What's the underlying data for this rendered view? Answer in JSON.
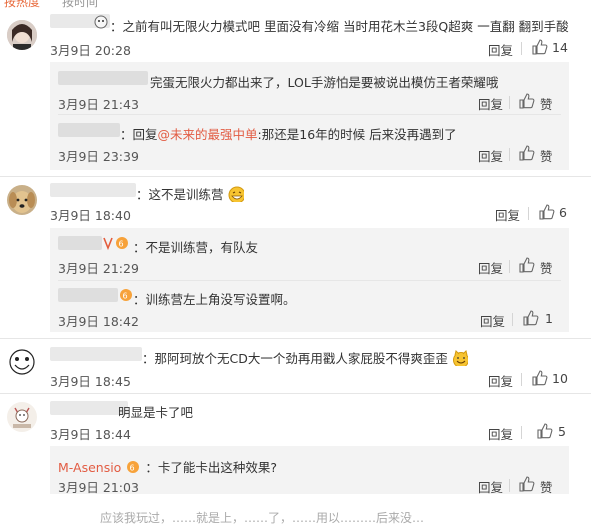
{
  "top": {
    "cut_label_1": "按热度",
    "cut_label_2": "按时间"
  },
  "comments": [
    {
      "text": "：之前有叫无限火力模式吧 里面没有冷缩  当时用花木兰3段Q超爽  一直翻  翻到手酸",
      "time": "3月9日 20:28",
      "reply_label": "回复",
      "likes": "14",
      "replies": [
        {
          "text": "完蛋无限火力都出来了，LOL手游怕是要被说出模仿王者荣耀哦",
          "time": "3月9日 21:43",
          "reply_label": "回复",
          "like_label": "赞"
        },
        {
          "prefix": "：回复",
          "mention": "@未来的最强中单",
          "text": ":那还是16年的时候  后来没再遇到了",
          "time": "3月9日 23:39",
          "reply_label": "回复",
          "like_label": "赞"
        }
      ]
    },
    {
      "text": "：这不是训练营",
      "time": "3月9日 18:40",
      "reply_label": "回复",
      "likes": "6",
      "replies": [
        {
          "text": "：不是训练营，有队友",
          "time": "3月9日 21:29",
          "reply_label": "回复",
          "like_label": "赞"
        },
        {
          "text": "：训练营左上角没写设置啊。",
          "time": "3月9日 18:42",
          "reply_label": "回复",
          "likes": "1"
        }
      ]
    },
    {
      "text": "：那阿珂放个无CD大一个劲再用戳人家屁股不得爽歪歪",
      "time": "3月9日 18:45",
      "reply_label": "回复",
      "likes": "10"
    },
    {
      "text": "明显是卡了吧",
      "time": "3月9日 18:44",
      "reply_label": "回复",
      "likes": "5",
      "replies": [
        {
          "user": "M-Asensio",
          "text": "：卡了能卡出这种效果?",
          "time": "3月9日 21:03",
          "reply_label": "回复",
          "like_label": "赞"
        }
      ]
    }
  ],
  "bottom": {
    "cut_text": "应该我玩过，……就是上，……了，……用以………后来没…"
  },
  "colors": {
    "link": "#e25c43",
    "subbox": "#f3f3f3",
    "text": "#333333",
    "muted": "#555555"
  }
}
